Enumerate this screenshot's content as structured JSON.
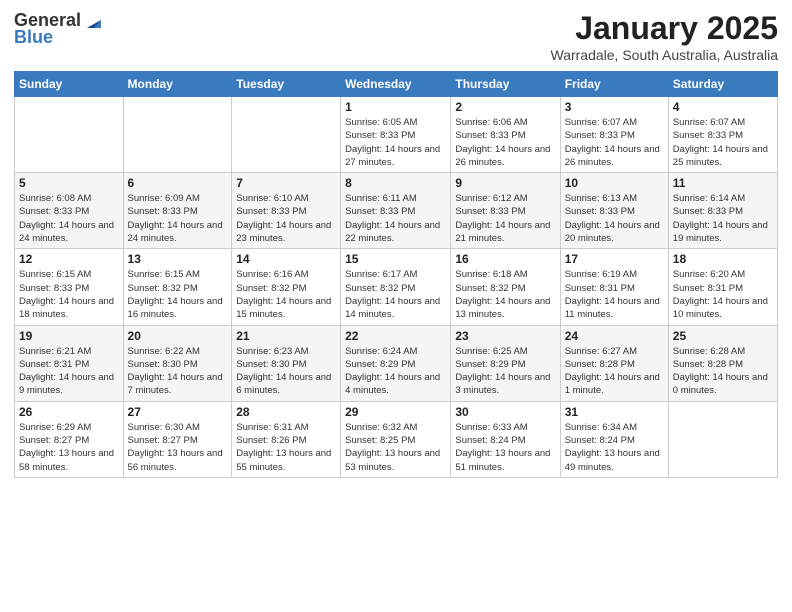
{
  "header": {
    "logo_line1": "General",
    "logo_line2": "Blue",
    "title": "January 2025",
    "subtitle": "Warradale, South Australia, Australia"
  },
  "days_of_week": [
    "Sunday",
    "Monday",
    "Tuesday",
    "Wednesday",
    "Thursday",
    "Friday",
    "Saturday"
  ],
  "weeks": [
    [
      {
        "day": "",
        "info": ""
      },
      {
        "day": "",
        "info": ""
      },
      {
        "day": "",
        "info": ""
      },
      {
        "day": "1",
        "info": "Sunrise: 6:05 AM\nSunset: 8:33 PM\nDaylight: 14 hours and 27 minutes."
      },
      {
        "day": "2",
        "info": "Sunrise: 6:06 AM\nSunset: 8:33 PM\nDaylight: 14 hours and 26 minutes."
      },
      {
        "day": "3",
        "info": "Sunrise: 6:07 AM\nSunset: 8:33 PM\nDaylight: 14 hours and 26 minutes."
      },
      {
        "day": "4",
        "info": "Sunrise: 6:07 AM\nSunset: 8:33 PM\nDaylight: 14 hours and 25 minutes."
      }
    ],
    [
      {
        "day": "5",
        "info": "Sunrise: 6:08 AM\nSunset: 8:33 PM\nDaylight: 14 hours and 24 minutes."
      },
      {
        "day": "6",
        "info": "Sunrise: 6:09 AM\nSunset: 8:33 PM\nDaylight: 14 hours and 24 minutes."
      },
      {
        "day": "7",
        "info": "Sunrise: 6:10 AM\nSunset: 8:33 PM\nDaylight: 14 hours and 23 minutes."
      },
      {
        "day": "8",
        "info": "Sunrise: 6:11 AM\nSunset: 8:33 PM\nDaylight: 14 hours and 22 minutes."
      },
      {
        "day": "9",
        "info": "Sunrise: 6:12 AM\nSunset: 8:33 PM\nDaylight: 14 hours and 21 minutes."
      },
      {
        "day": "10",
        "info": "Sunrise: 6:13 AM\nSunset: 8:33 PM\nDaylight: 14 hours and 20 minutes."
      },
      {
        "day": "11",
        "info": "Sunrise: 6:14 AM\nSunset: 8:33 PM\nDaylight: 14 hours and 19 minutes."
      }
    ],
    [
      {
        "day": "12",
        "info": "Sunrise: 6:15 AM\nSunset: 8:33 PM\nDaylight: 14 hours and 18 minutes."
      },
      {
        "day": "13",
        "info": "Sunrise: 6:15 AM\nSunset: 8:32 PM\nDaylight: 14 hours and 16 minutes."
      },
      {
        "day": "14",
        "info": "Sunrise: 6:16 AM\nSunset: 8:32 PM\nDaylight: 14 hours and 15 minutes."
      },
      {
        "day": "15",
        "info": "Sunrise: 6:17 AM\nSunset: 8:32 PM\nDaylight: 14 hours and 14 minutes."
      },
      {
        "day": "16",
        "info": "Sunrise: 6:18 AM\nSunset: 8:32 PM\nDaylight: 14 hours and 13 minutes."
      },
      {
        "day": "17",
        "info": "Sunrise: 6:19 AM\nSunset: 8:31 PM\nDaylight: 14 hours and 11 minutes."
      },
      {
        "day": "18",
        "info": "Sunrise: 6:20 AM\nSunset: 8:31 PM\nDaylight: 14 hours and 10 minutes."
      }
    ],
    [
      {
        "day": "19",
        "info": "Sunrise: 6:21 AM\nSunset: 8:31 PM\nDaylight: 14 hours and 9 minutes."
      },
      {
        "day": "20",
        "info": "Sunrise: 6:22 AM\nSunset: 8:30 PM\nDaylight: 14 hours and 7 minutes."
      },
      {
        "day": "21",
        "info": "Sunrise: 6:23 AM\nSunset: 8:30 PM\nDaylight: 14 hours and 6 minutes."
      },
      {
        "day": "22",
        "info": "Sunrise: 6:24 AM\nSunset: 8:29 PM\nDaylight: 14 hours and 4 minutes."
      },
      {
        "day": "23",
        "info": "Sunrise: 6:25 AM\nSunset: 8:29 PM\nDaylight: 14 hours and 3 minutes."
      },
      {
        "day": "24",
        "info": "Sunrise: 6:27 AM\nSunset: 8:28 PM\nDaylight: 14 hours and 1 minute."
      },
      {
        "day": "25",
        "info": "Sunrise: 6:28 AM\nSunset: 8:28 PM\nDaylight: 14 hours and 0 minutes."
      }
    ],
    [
      {
        "day": "26",
        "info": "Sunrise: 6:29 AM\nSunset: 8:27 PM\nDaylight: 13 hours and 58 minutes."
      },
      {
        "day": "27",
        "info": "Sunrise: 6:30 AM\nSunset: 8:27 PM\nDaylight: 13 hours and 56 minutes."
      },
      {
        "day": "28",
        "info": "Sunrise: 6:31 AM\nSunset: 8:26 PM\nDaylight: 13 hours and 55 minutes."
      },
      {
        "day": "29",
        "info": "Sunrise: 6:32 AM\nSunset: 8:25 PM\nDaylight: 13 hours and 53 minutes."
      },
      {
        "day": "30",
        "info": "Sunrise: 6:33 AM\nSunset: 8:24 PM\nDaylight: 13 hours and 51 minutes."
      },
      {
        "day": "31",
        "info": "Sunrise: 6:34 AM\nSunset: 8:24 PM\nDaylight: 13 hours and 49 minutes."
      },
      {
        "day": "",
        "info": ""
      }
    ]
  ]
}
